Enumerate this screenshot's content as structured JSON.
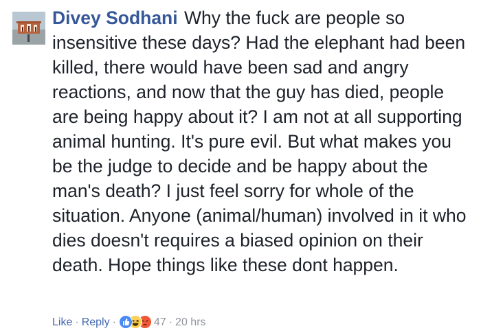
{
  "comment": {
    "author": "Divey Sodhani",
    "text": "Why the fuck are people so insensitive these days? Had the elephant had been killed, there would have been sad and angry reactions, and now that the guy has died, people are being happy about it? I am not at all supporting animal hunting. It's pure evil. But what makes you be the judge to decide and be happy about the man's death? I just feel sorry for whole of the situation. Anyone (animal/human) involved in it who dies doesn't requires a biased opinion on their death. Hope things like these dont happen.",
    "actions": {
      "like": "Like",
      "reply": "Reply",
      "separator": "·"
    },
    "reactions": {
      "icons": [
        "like-icon",
        "haha-icon",
        "angry-icon"
      ],
      "count": "47"
    },
    "timestamp": "20 hrs"
  },
  "colors": {
    "author": "#365899",
    "text": "#1d2129",
    "link": "#4267b2",
    "meta": "#90949c"
  }
}
